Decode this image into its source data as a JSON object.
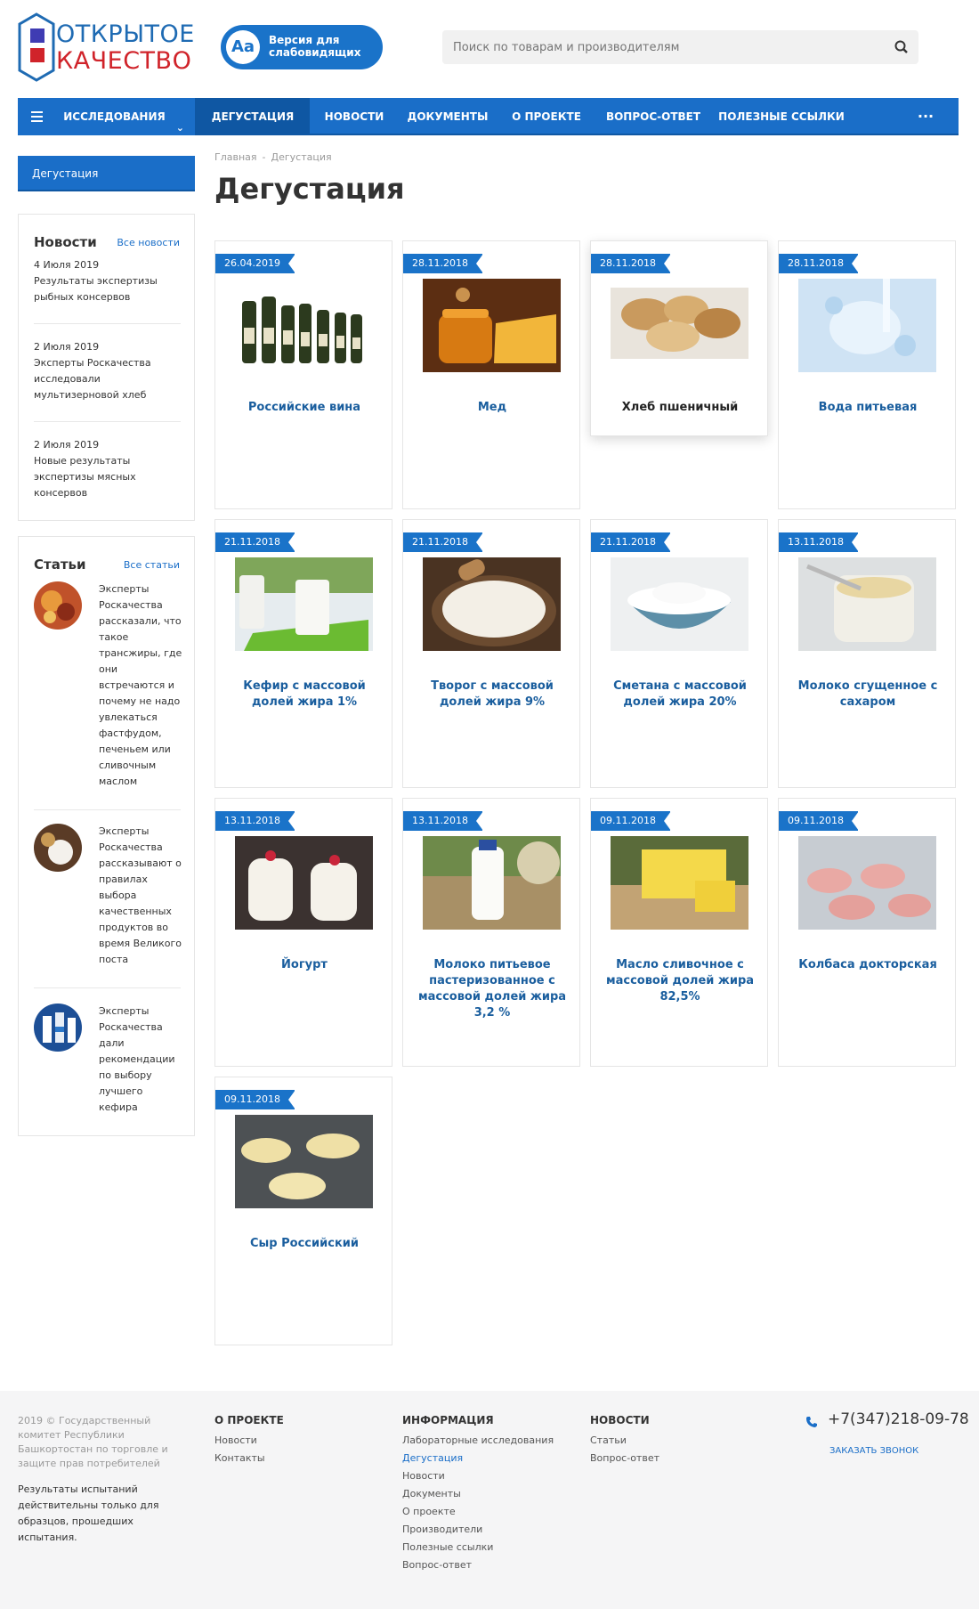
{
  "header": {
    "logo_line1": "ОТКРЫТОЕ",
    "logo_line2": "КАЧЕСТВО",
    "vision_icon": "Aa",
    "vision_label": "Версия для слабовидящих",
    "search_placeholder": "Поиск по товарам и производителям"
  },
  "nav": {
    "research": "Исследования",
    "items": [
      "Дегустация",
      "Новости",
      "Документы",
      "О проекте",
      "Вопрос-ответ",
      "Полезные ссылки"
    ],
    "more": "···"
  },
  "sidebar": {
    "active": "Дегустация",
    "news_title": "Новости",
    "news_link": "Все новости",
    "news": [
      {
        "date": "4 Июля 2019",
        "text": "Результаты экспертизы рыбных консервов"
      },
      {
        "date": "2 Июля 2019",
        "text": "Эксперты Роскачества исследовали мультизерновой хлеб"
      },
      {
        "date": "2 Июля 2019",
        "text": "Новые результаты экспертизы мясных консервов"
      }
    ],
    "articles_title": "Статьи",
    "articles_link": "Все статьи",
    "articles": [
      "Эксперты Роскачества рассказали, что такое трансжиры, где они встречаются и почему не надо увлекаться фастфудом, печеньем или сливочным маслом",
      "Эксперты Роскачества рассказывают о правилах выбора качественных продуктов во время Великого поста",
      "Эксперты Роскачества дали рекомендации по выбору лучшего кефира"
    ]
  },
  "breadcrumb": [
    "Главная",
    "-",
    "Дегустация"
  ],
  "page_title": "Дегустация",
  "cards": [
    {
      "date": "26.04.2019",
      "title": "Российские вина"
    },
    {
      "date": "28.11.2018",
      "title": "Мед"
    },
    {
      "date": "28.11.2018",
      "title": "Хлеб пшеничный"
    },
    {
      "date": "28.11.2018",
      "title": "Вода питьевая"
    },
    {
      "date": "21.11.2018",
      "title": "Кефир с массовой долей жира 1%"
    },
    {
      "date": "21.11.2018",
      "title": "Творог с массовой долей жира 9%"
    },
    {
      "date": "21.11.2018",
      "title": "Сметана с массовой долей жира 20%"
    },
    {
      "date": "13.11.2018",
      "title": "Молоко сгущенное с сахаром"
    },
    {
      "date": "13.11.2018",
      "title": "Йогурт"
    },
    {
      "date": "13.11.2018",
      "title": "Молоко питьевое пастеризованное с массовой долей жира 3,2 %"
    },
    {
      "date": "09.11.2018",
      "title": "Масло сливочное с массовой долей жира 82,5%"
    },
    {
      "date": "09.11.2018",
      "title": "Колбаса докторская"
    },
    {
      "date": "09.11.2018",
      "title": "Сыр Российский"
    }
  ],
  "footer": {
    "copyright": "2019 © Государственный комитет Республики Башкортостан по торговле и защите прав потребителей",
    "note": "Результаты испытаний действительны только для образцов, прошедших испытания.",
    "col1_head": "О проекте",
    "col1": [
      "Новости",
      "Контакты"
    ],
    "col2_head": "Информация",
    "col2": [
      "Лабораторные исследования",
      "Дегустация",
      "Новости",
      "Документы",
      "О проекте",
      "Производители",
      "Полезные ссылки",
      "Вопрос-ответ"
    ],
    "col3_head": "Новости",
    "col3": [
      "Статьи",
      "Вопрос-ответ"
    ],
    "phone": "+7(347)218-09-78",
    "callback": "Заказать звонок"
  },
  "colors": {
    "accent": "#1a6ec8",
    "accent_dark": "#0f57a3",
    "logo_red": "#d0232a"
  }
}
